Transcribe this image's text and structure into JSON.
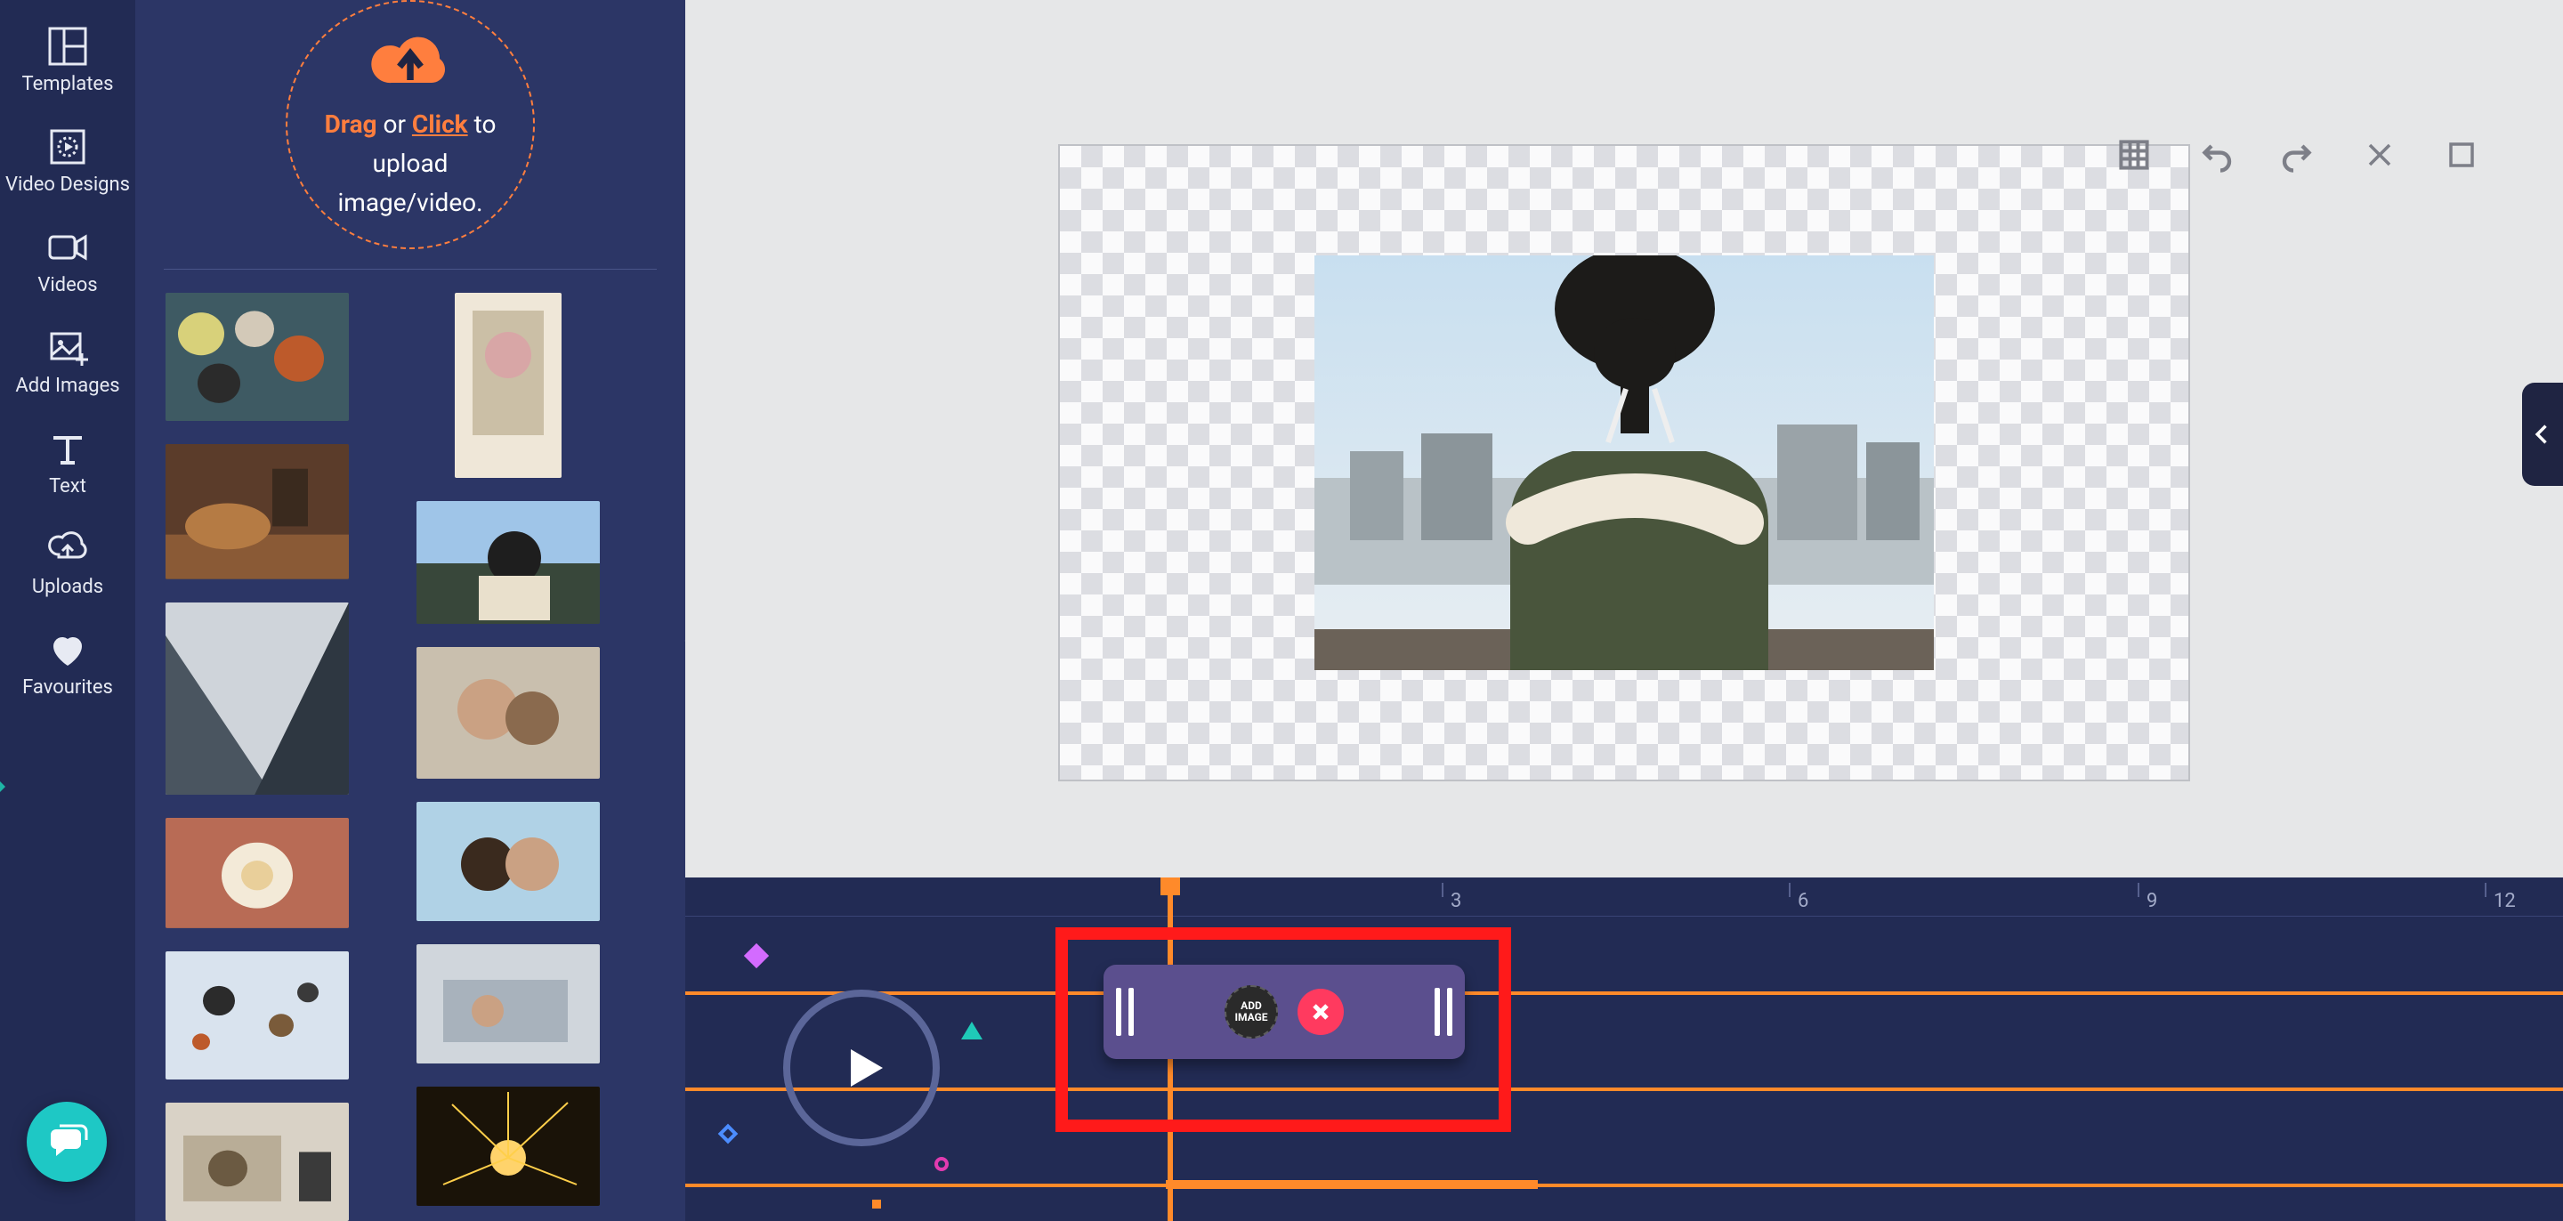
{
  "leftrail": {
    "items": [
      {
        "label": "Templates"
      },
      {
        "label": "Video Designs"
      },
      {
        "label": "Videos"
      },
      {
        "label": "Add Images"
      },
      {
        "label": "Text"
      },
      {
        "label": "Uploads"
      },
      {
        "label": "Favourites"
      }
    ]
  },
  "dropzone": {
    "drag": "Drag",
    "or": " or ",
    "click": "Click",
    "to": " to ",
    "line2": "upload",
    "line3": "image/video."
  },
  "clip": {
    "badge_l1": "ADD",
    "badge_l2": "IMAGE"
  },
  "ruler": {
    "ticks": [
      {
        "label": "3",
        "pos": 850
      },
      {
        "label": "6",
        "pos": 1240
      },
      {
        "label": "9",
        "pos": 1632
      },
      {
        "label": "12",
        "pos": 2022
      }
    ]
  }
}
